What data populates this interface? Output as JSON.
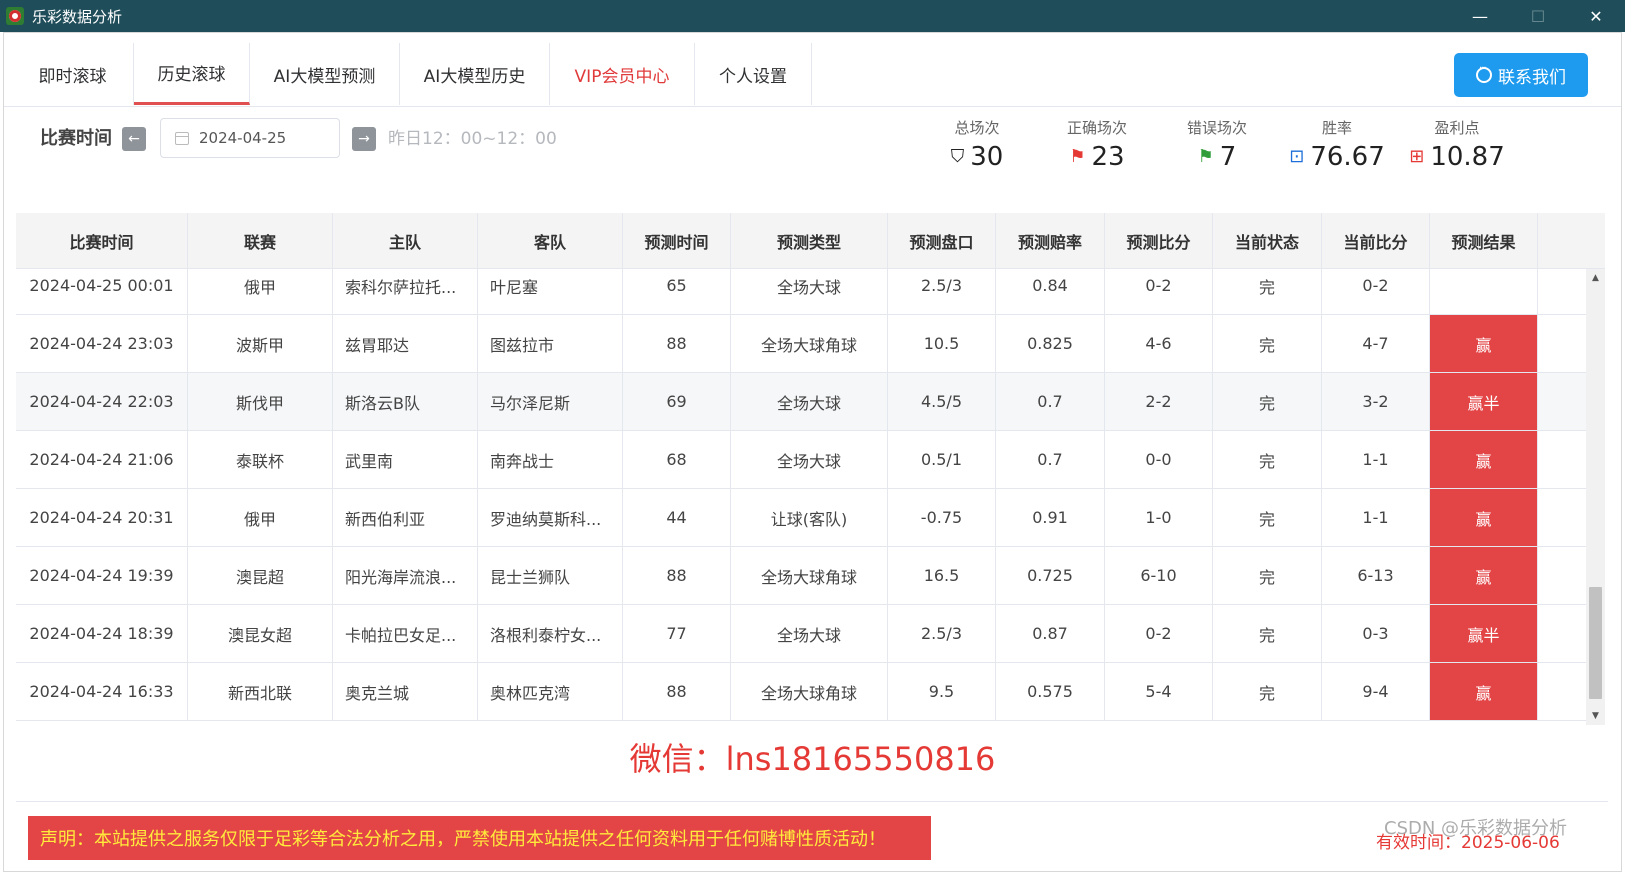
{
  "window": {
    "title": "乐彩数据分析",
    "minimize": "—",
    "maximize": "☐",
    "close": "✕"
  },
  "tabs": [
    {
      "label": "即时滚球"
    },
    {
      "label": "历史滚球"
    },
    {
      "label": "AI大模型预测"
    },
    {
      "label": "AI大模型历史"
    },
    {
      "label": "VIP会员中心"
    },
    {
      "label": "个人设置"
    }
  ],
  "active_tab": "历史滚球",
  "contact_button": "联系我们",
  "filter": {
    "label": "比赛时间",
    "prev_icon": "←",
    "next_icon": "→",
    "date_value": "2024-04-25",
    "range_text": "昨日12：00~12：00"
  },
  "stats": [
    {
      "label": "总场次",
      "value": "30",
      "icon": "bookmark-icon",
      "glyph": "⛉",
      "color": "#222222"
    },
    {
      "label": "正确场次",
      "value": "23",
      "icon": "red-flag-icon",
      "glyph": "⚑",
      "color": "#e53935"
    },
    {
      "label": "错误场次",
      "value": "7",
      "icon": "green-flag-icon",
      "glyph": "⚑",
      "color": "#2e9d3a"
    },
    {
      "label": "胜率",
      "value": "76.67",
      "icon": "chart-board-icon",
      "glyph": "⊡",
      "color": "#1e6fd9"
    },
    {
      "label": "盈利点",
      "value": "10.87",
      "icon": "gift-icon",
      "glyph": "⊞",
      "color": "#e53935"
    }
  ],
  "table": {
    "headers": [
      "比赛时间",
      "联赛",
      "主队",
      "客队",
      "预测时间",
      "预测类型",
      "预测盘口",
      "预测赔率",
      "预测比分",
      "当前状态",
      "当前比分",
      "预测结果"
    ],
    "rows": [
      [
        "2024-04-25 00:01",
        "俄甲",
        "索科尔萨拉托...",
        "叶尼塞",
        "65",
        "全场大球",
        "2.5/3",
        "0.84",
        "0-2",
        "完",
        "0-2",
        ""
      ],
      [
        "2024-04-24 23:03",
        "波斯甲",
        "兹胃耶达",
        "图兹拉市",
        "88",
        "全场大球角球",
        "10.5",
        "0.825",
        "4-6",
        "完",
        "4-7",
        "赢"
      ],
      [
        "2024-04-24 22:03",
        "斯伐甲",
        "斯洛云B队",
        "马尔泽尼斯",
        "69",
        "全场大球",
        "4.5/5",
        "0.7",
        "2-2",
        "完",
        "3-2",
        "赢半"
      ],
      [
        "2024-04-24 21:06",
        "泰联杯",
        "武里南",
        "南奔战士",
        "68",
        "全场大球",
        "0.5/1",
        "0.7",
        "0-0",
        "完",
        "1-1",
        "赢"
      ],
      [
        "2024-04-24 20:31",
        "俄甲",
        "新西伯利亚",
        "罗迪纳莫斯科...",
        "44",
        "让球(客队)",
        "-0.75",
        "0.91",
        "1-0",
        "完",
        "1-1",
        "赢"
      ],
      [
        "2024-04-24 19:39",
        "澳昆超",
        "阳光海岸流浪...",
        "昆士兰狮队",
        "88",
        "全场大球角球",
        "16.5",
        "0.725",
        "6-10",
        "完",
        "6-13",
        "赢"
      ],
      [
        "2024-04-24 18:39",
        "澳昆女超",
        "卡帕拉巴女足...",
        "洛根利泰柠女...",
        "77",
        "全场大球",
        "2.5/3",
        "0.87",
        "0-2",
        "完",
        "0-3",
        "赢半"
      ],
      [
        "2024-04-24 16:33",
        "新西北联",
        "奥克兰城",
        "奥林匹克湾",
        "88",
        "全场大球角球",
        "9.5",
        "0.575",
        "5-4",
        "完",
        "9-4",
        "赢"
      ]
    ],
    "highlighted_row": 2
  },
  "scroll_up": "▲",
  "scroll_down": "▼",
  "wechat": "微信：lns18165550816",
  "notice": "声明：本站提供之服务仅限于足彩等合法分析之用，严禁使用本站提供之任何资料用于任何赌博性质活动！",
  "valid_until": "有效时间：2025-06-06",
  "watermark": "CSDN @乐彩数据分析",
  "colors": {
    "titlebar": "#1f4e5a",
    "accent": "#1e9bef",
    "win_cell": "#e34547",
    "warning_text": "#ffeb3b"
  }
}
